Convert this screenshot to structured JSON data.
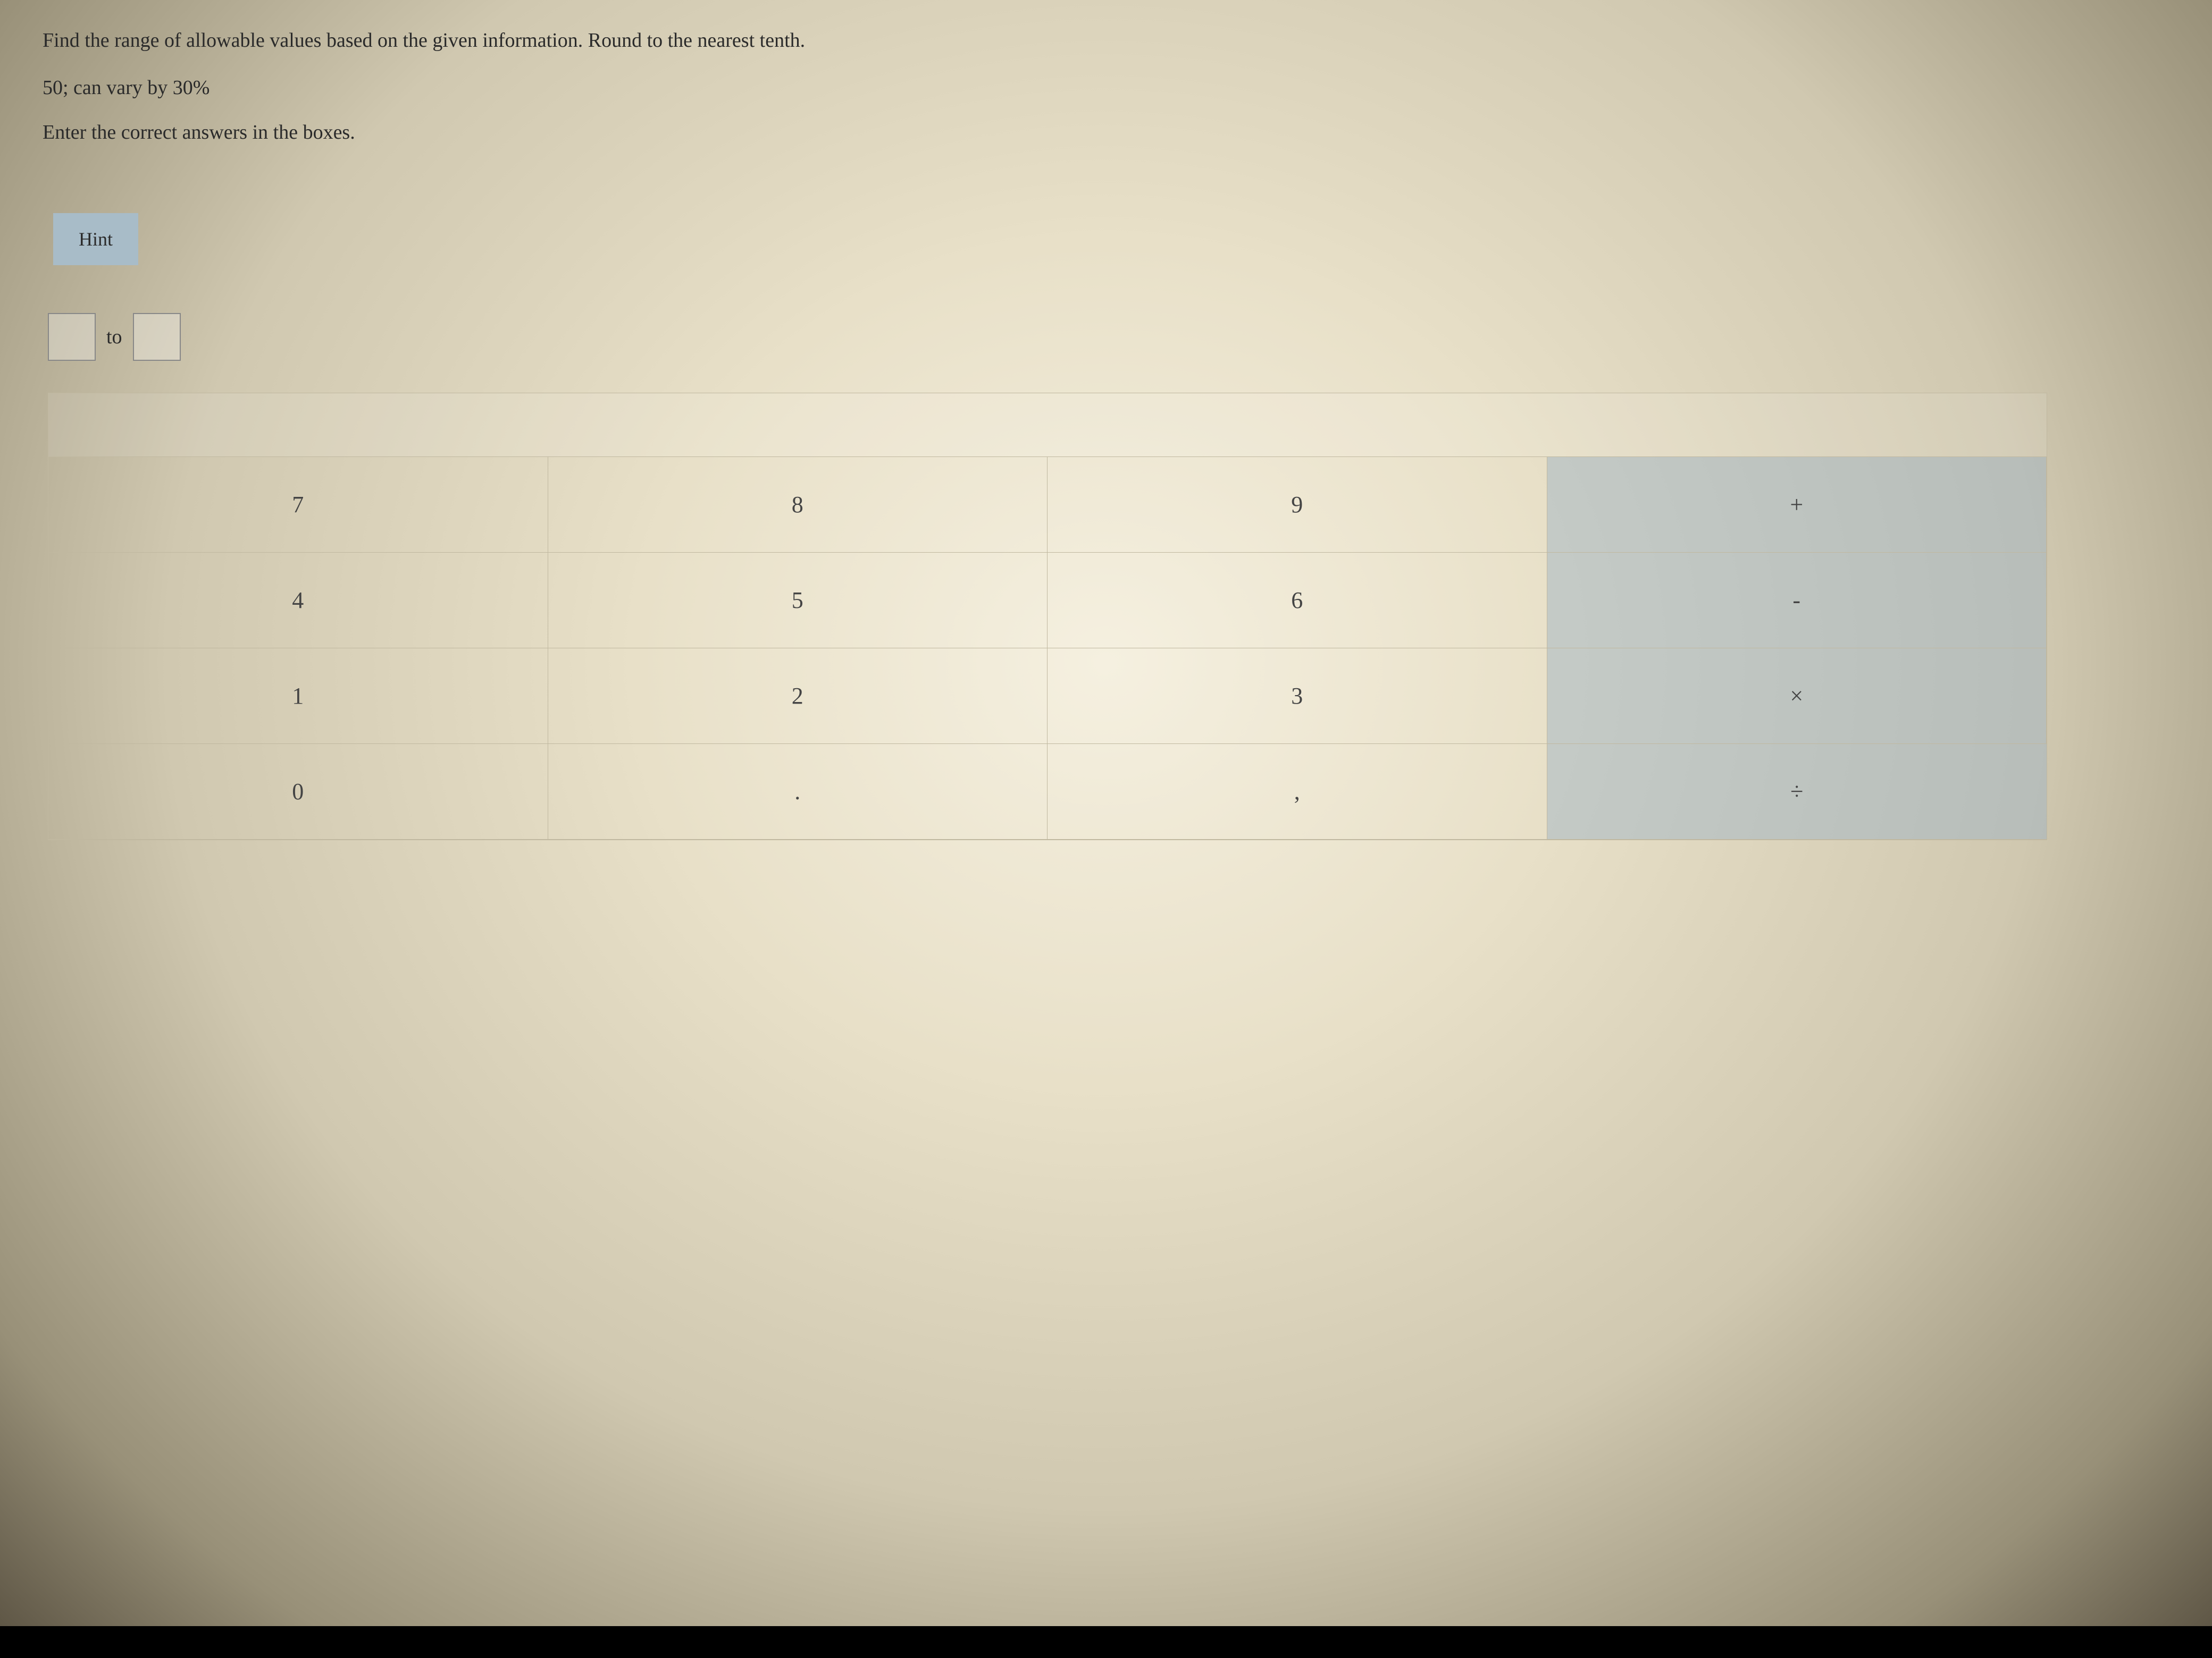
{
  "question": {
    "prompt": "Find the range of allowable values based on the given information. Round to the nearest tenth.",
    "given": "50; can vary by 30%",
    "instructions": "Enter the correct answers in the boxes."
  },
  "hint": {
    "label": "Hint"
  },
  "answer": {
    "input1_value": "",
    "connector": "to",
    "input2_value": ""
  },
  "keypad": {
    "rows": [
      [
        "7",
        "8",
        "9",
        "+"
      ],
      [
        "4",
        "5",
        "6",
        "-"
      ],
      [
        "1",
        "2",
        "3",
        "×"
      ],
      [
        "0",
        ".",
        ",",
        "÷"
      ]
    ]
  }
}
